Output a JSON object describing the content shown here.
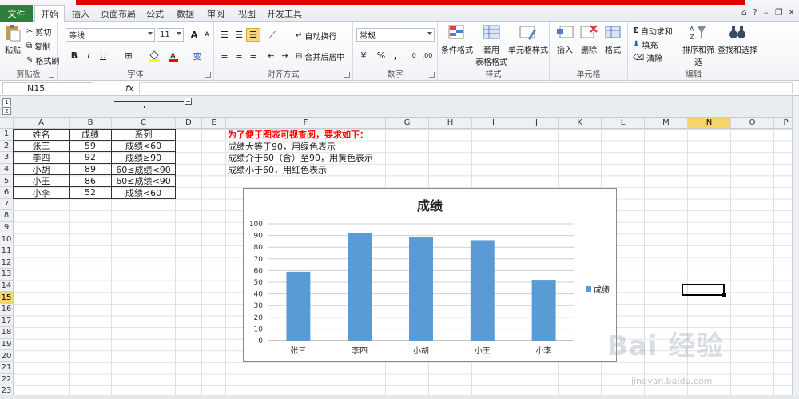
{
  "ribbon_tabs": {
    "file": "文件",
    "home": "开始",
    "insert": "插入",
    "layout": "页面布局",
    "formulas": "公式",
    "data": "数据",
    "review": "审阅",
    "view": "视图",
    "developer": "开发工具"
  },
  "clipboard": {
    "paste": "粘贴",
    "cut": "剪切",
    "copy": "复制",
    "format_painter": "格式刷",
    "label": "剪贴板"
  },
  "font": {
    "name": "等线",
    "size": "11",
    "bold": "B",
    "italic": "I",
    "underline": "U",
    "label": "字体",
    "grow": "A",
    "shrink": "A",
    "phonetic": "变"
  },
  "alignment": {
    "wrap": "自动换行",
    "merge": "合并后居中",
    "label": "对齐方式"
  },
  "number": {
    "format": "常规",
    "percent": "%",
    "comma": ",",
    "label": "数字"
  },
  "styles": {
    "conditional": "条件格式",
    "table_line1": "套用",
    "table_line2": "表格格式",
    "cell_styles": "单元格样式",
    "label": "样式"
  },
  "cells": {
    "insert": "插入",
    "delete": "删除",
    "format": "格式",
    "label": "单元格"
  },
  "editing": {
    "autosum": "自动求和",
    "fill": "填充",
    "clear": "清除",
    "sort": "排序和筛选",
    "find": "查找和选择",
    "label": "编辑"
  },
  "formula_bar": {
    "name_box": "N15",
    "fx": "fx"
  },
  "outline_levels": [
    "1",
    "2"
  ],
  "columns": [
    "A",
    "B",
    "C",
    "D",
    "E",
    "F",
    "G",
    "H",
    "I",
    "J",
    "K",
    "L",
    "M",
    "N",
    "O",
    "P"
  ],
  "rows": [
    "1",
    "2",
    "3",
    "4",
    "5",
    "6",
    "7",
    "8",
    "9",
    "10",
    "11",
    "12",
    "13",
    "14",
    "15",
    "16",
    "17",
    "18",
    "19",
    "20",
    "21",
    "22",
    "23"
  ],
  "table": {
    "headers": [
      "姓名",
      "成绩",
      "系列"
    ],
    "rows": [
      [
        "张三",
        "59",
        "成绩<60"
      ],
      [
        "李四",
        "92",
        "成绩≥90"
      ],
      [
        "小胡",
        "89",
        "60≤成绩<90"
      ],
      [
        "小王",
        "86",
        "60≤成绩<90"
      ],
      [
        "小李",
        "52",
        "成绩<60"
      ]
    ]
  },
  "notes": {
    "title": "为了便于图表可视查阅，要求如下：",
    "line1": "成绩大等于90，用绿色表示",
    "line2": "成绩介于60（含）至90，用黄色表示",
    "line3": "成绩小于60，用红色表示"
  },
  "colors": {
    "accent": "#2f7d3a",
    "bar": "#5b9bd5",
    "note_red": "#ff0000",
    "selected_header": "#f6d36b"
  },
  "watermark": {
    "brand": "Bai 经验",
    "url": "jingyan.baidu.com"
  },
  "chart_data": {
    "type": "bar",
    "title": "成绩",
    "categories": [
      "张三",
      "李四",
      "小胡",
      "小王",
      "小李"
    ],
    "series": [
      {
        "name": "成绩",
        "values": [
          59,
          92,
          89,
          86,
          52
        ]
      }
    ],
    "ylim": [
      0,
      100
    ],
    "yticks": [
      0,
      10,
      20,
      30,
      40,
      50,
      60,
      70,
      80,
      90,
      100
    ],
    "grid": true,
    "legend": "right"
  }
}
